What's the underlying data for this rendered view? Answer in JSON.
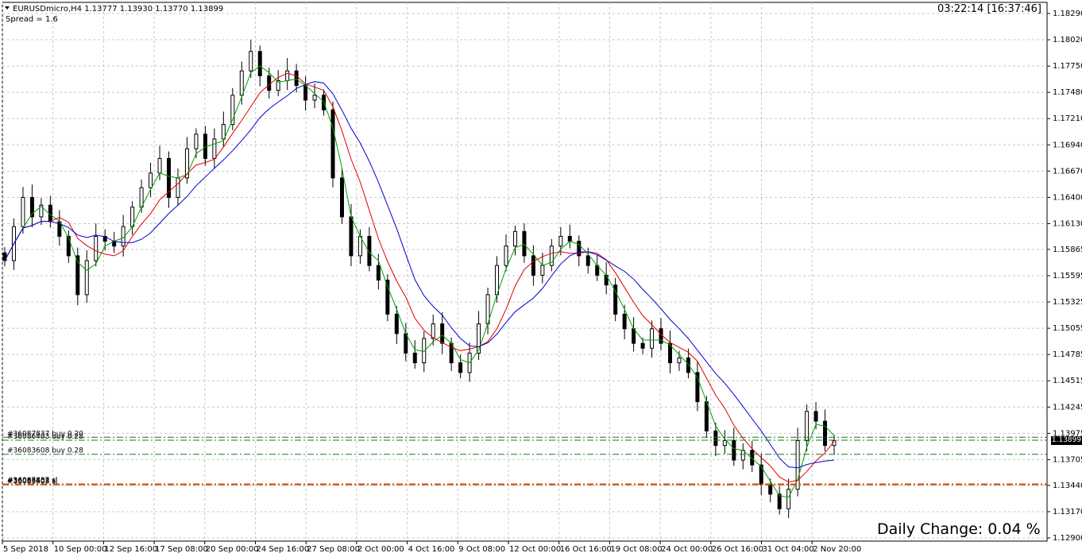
{
  "header": {
    "symbol_line": "EURUSDmicro,H4  1.13777 1.13930 1.13770 1.13899",
    "spread": "Spread = 1.6",
    "clock": "03:22:14 [16:37:46]"
  },
  "daily_change": "Daily Change: 0.04 %",
  "current_price": "1.13899",
  "price_axis_labels": [
    "1.18290",
    "1.18020",
    "1.17750",
    "1.17480",
    "1.17210",
    "1.16940",
    "1.16670",
    "1.16400",
    "1.16130",
    "1.15865",
    "1.15595",
    "1.15325",
    "1.15055",
    "1.14785",
    "1.14515",
    "1.14245",
    "1.13975",
    "1.13705",
    "1.13440",
    "1.13170",
    "1.12900"
  ],
  "time_axis_labels": [
    "5 Sep 2018",
    "10 Sep 00:00",
    "12 Sep 16:00",
    "17 Sep 08:00",
    "20 Sep 00:00",
    "24 Sep 16:00",
    "27 Sep 08:00",
    "2 Oct 00:00",
    "4 Oct 16:00",
    "9 Oct 08:00",
    "12 Oct 00:00",
    "16 Oct 16:00",
    "19 Oct 08:00",
    "24 Oct 00:00",
    "26 Oct 16:00",
    "31 Oct 04:00",
    "2 Nov 20:00"
  ],
  "order_lines": [
    {
      "label": "#36087837 buy 0.20",
      "price": 1.13935,
      "color": "#1a7a1a"
    },
    {
      "label": "#36086403 buy 0.28",
      "price": 1.13905,
      "color": "#1a7a1a"
    },
    {
      "label": "#36083608 buy 0.28",
      "price": 1.1376,
      "color": "#1a7a1a"
    },
    {
      "label": "#36087837 sl",
      "price": 1.13455,
      "color": "#d05010"
    },
    {
      "label": "#36086403 sl",
      "price": 1.1345,
      "color": "#d05010"
    },
    {
      "label": "#36083608 sl",
      "price": 1.13445,
      "color": "#d05010"
    }
  ],
  "colors": {
    "background": "#ffffff",
    "grid": "#c8c8c8",
    "candle": "#000000",
    "ma_fast": "#00a000",
    "ma_mid": "#e00000",
    "ma_slow": "#0000d0",
    "buy_line": "#1a7a1a",
    "sl_line": "#d05010"
  },
  "chart_data": {
    "type": "candlestick",
    "title": "EURUSDmicro,H4",
    "ylim": [
      1.129,
      1.1829
    ],
    "ohlc_series_close": [
      1.1575,
      1.161,
      1.164,
      1.162,
      1.1632,
      1.1615,
      1.16,
      1.158,
      1.154,
      1.1575,
      1.16,
      1.1595,
      1.159,
      1.161,
      1.163,
      1.165,
      1.1665,
      1.168,
      1.164,
      1.166,
      1.169,
      1.1705,
      1.168,
      1.17,
      1.1715,
      1.1745,
      1.177,
      1.179,
      1.1765,
      1.175,
      1.176,
      1.177,
      1.1755,
      1.174,
      1.1745,
      1.173,
      1.166,
      1.162,
      1.158,
      1.16,
      1.157,
      1.1555,
      1.152,
      1.15,
      1.148,
      1.147,
      1.1495,
      1.151,
      1.149,
      1.147,
      1.146,
      1.148,
      1.151,
      1.154,
      1.157,
      1.159,
      1.1605,
      1.158,
      1.156,
      1.157,
      1.159,
      1.16,
      1.1595,
      1.158,
      1.157,
      1.156,
      1.155,
      1.152,
      1.1505,
      1.149,
      1.1485,
      1.1505,
      1.149,
      1.147,
      1.1475,
      1.146,
      1.143,
      1.14,
      1.1385,
      1.139,
      1.137,
      1.138,
      1.1365,
      1.1345,
      1.1335,
      1.132,
      1.134,
      1.139,
      1.142,
      1.141,
      1.1385,
      1.139
    ]
  }
}
